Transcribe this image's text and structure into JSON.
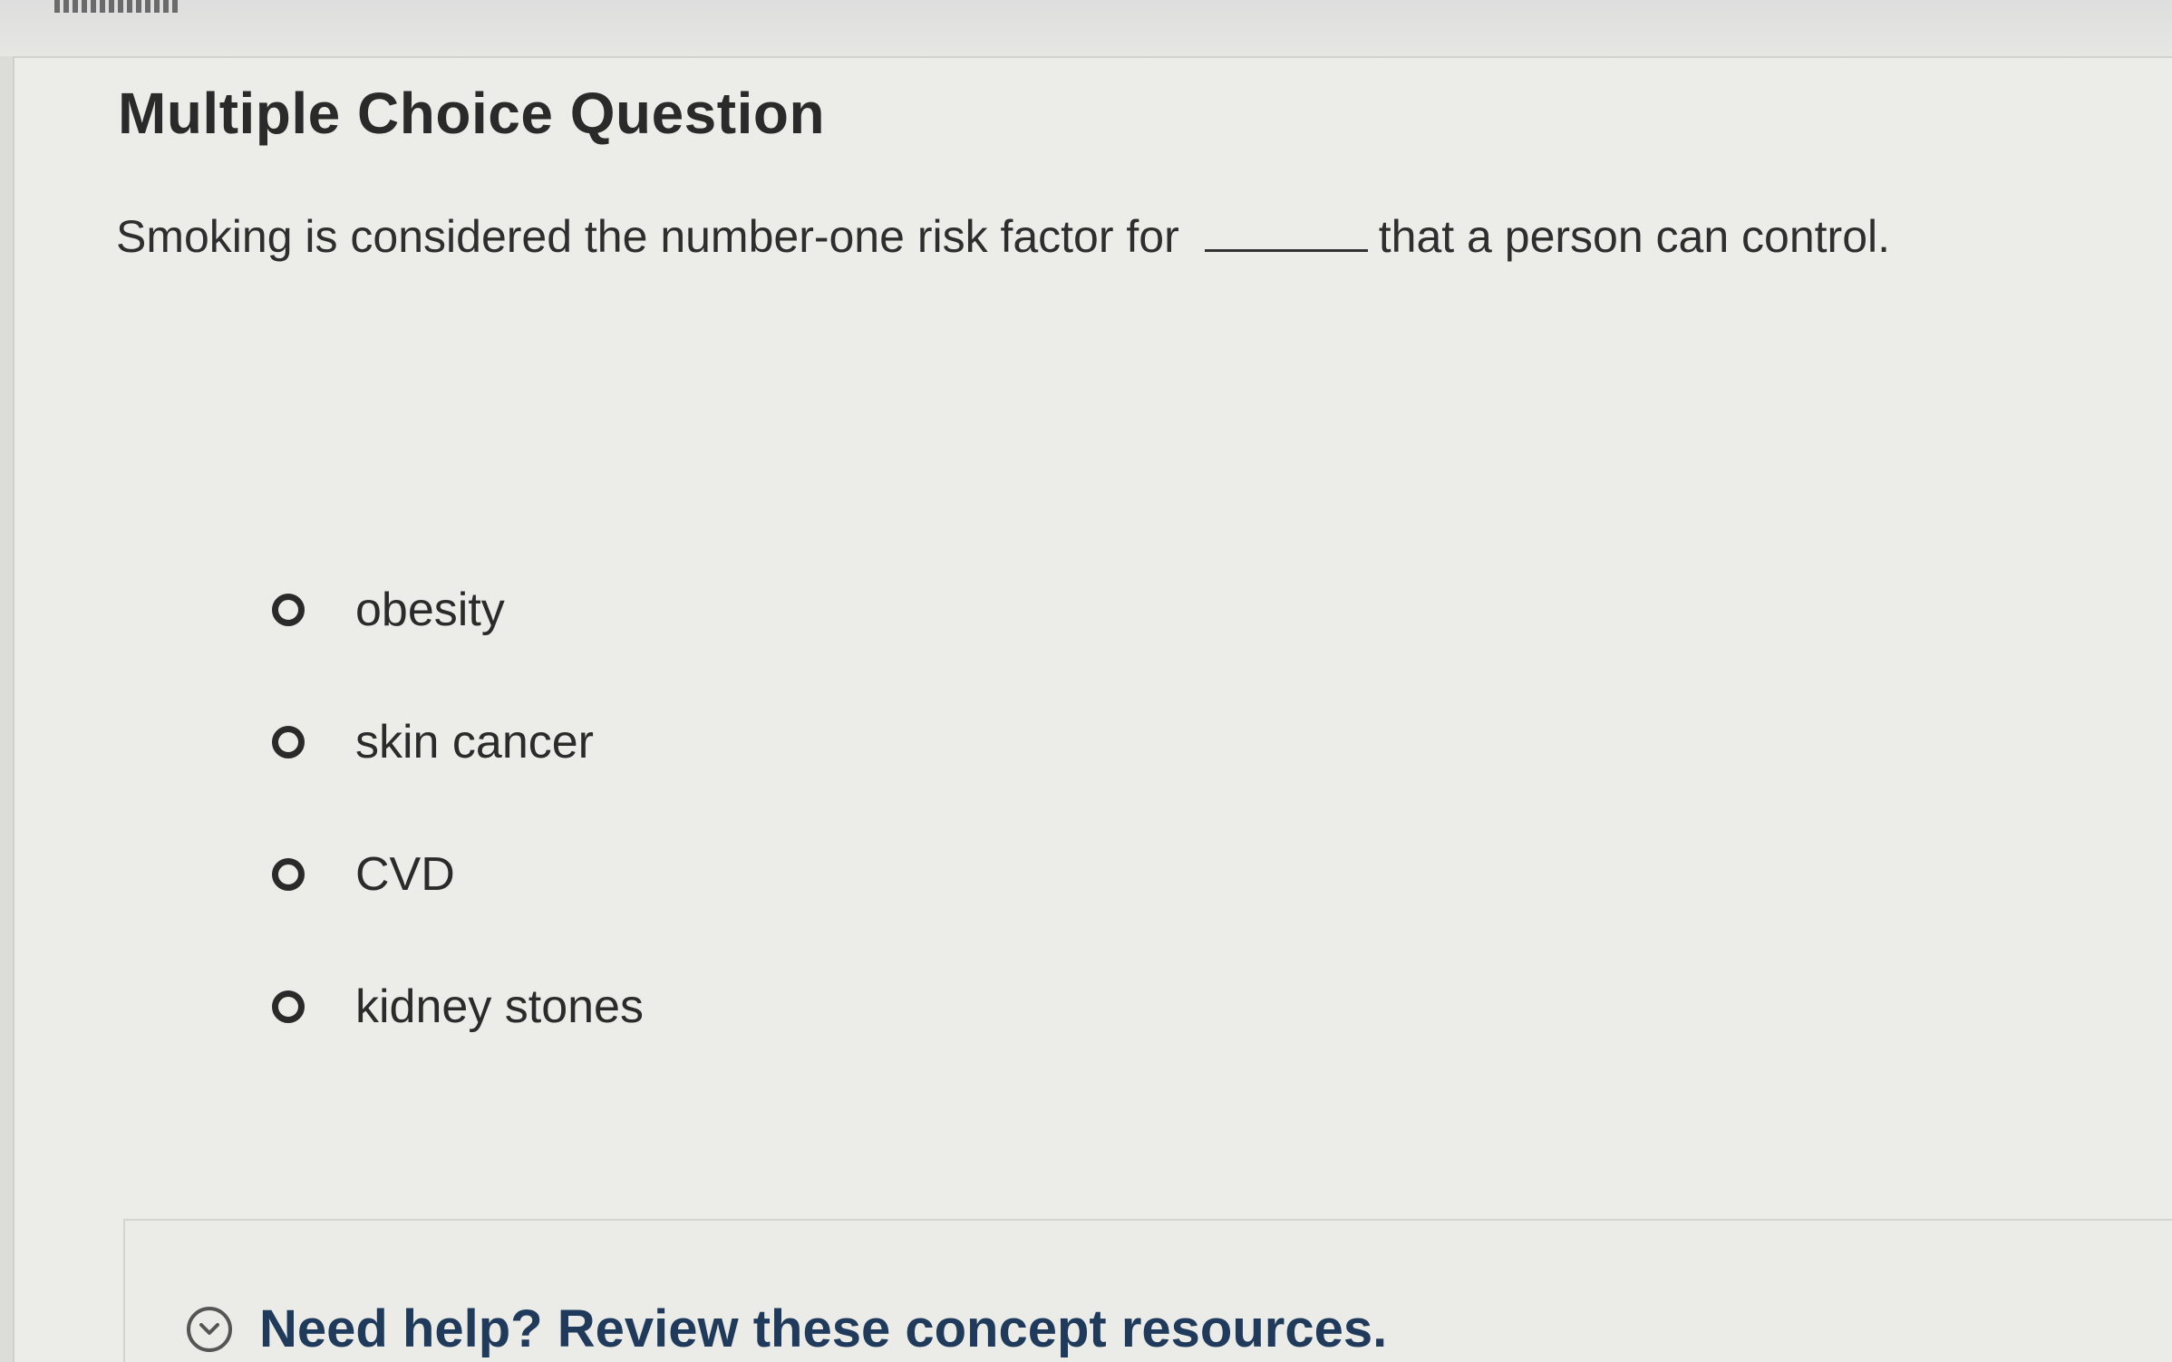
{
  "question": {
    "type_label": "Multiple Choice Question",
    "prompt_before": "Smoking is considered the number-one risk factor for",
    "prompt_after": "that a person can control."
  },
  "choices": [
    {
      "label": "obesity"
    },
    {
      "label": "skin cancer"
    },
    {
      "label": "CVD"
    },
    {
      "label": "kidney stones"
    }
  ],
  "help": {
    "icon": "chevron-down-icon",
    "link_text": "Need help? Review these concept resources."
  }
}
